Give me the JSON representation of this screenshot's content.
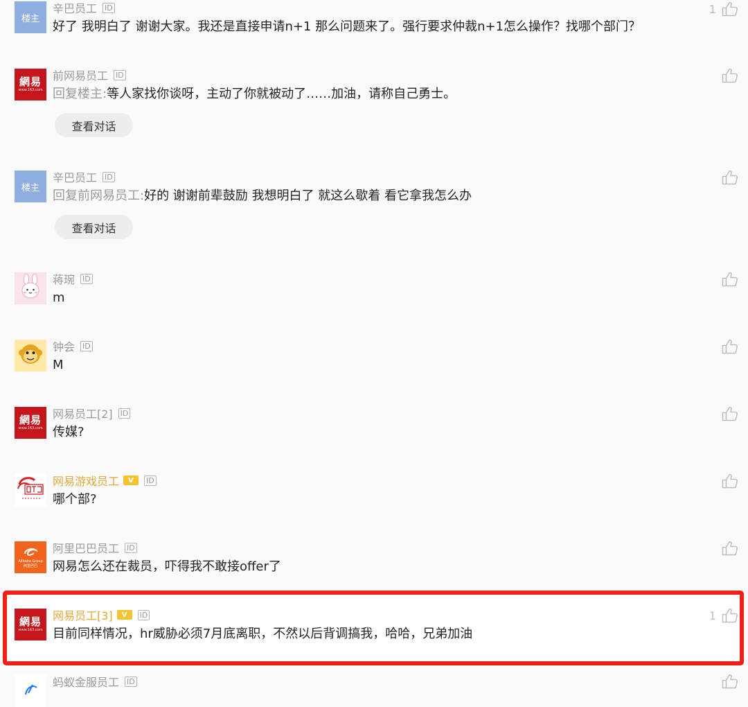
{
  "comments": [
    {
      "user": "辛巴员工",
      "avatar": "楼主",
      "id_badge": "ID",
      "content": "好了 我明白了 谢谢大家。我还是直接申请n+1 那么问题来了。强行要求仲裁n+1怎么操作？找哪个部门？",
      "likes": "1"
    },
    {
      "user": "前网易员工",
      "avatar": "網易",
      "avatar_sub": "www.163.com",
      "id_badge": "ID",
      "reply_to": "回复楼主:",
      "content": "等人家找你谈呀，主动了你就被动了……加油，请称自己勇士。",
      "button": "查看对话"
    },
    {
      "user": "辛巴员工",
      "avatar": "楼主",
      "id_badge": "ID",
      "reply_to": "回复前网易员工:",
      "content": "好的 谢谢前辈鼓励 我想明白了 就这么歇着 看它拿我怎么办",
      "button": "查看对话"
    },
    {
      "user": "蒋琬",
      "avatar_icon": "rabbit-avatar-icon",
      "id_badge": "ID",
      "content": "m"
    },
    {
      "user": "钟会",
      "avatar_icon": "monkey-avatar-icon",
      "id_badge": "ID",
      "content": "M"
    },
    {
      "user": "网易员工[2]",
      "avatar": "網易",
      "avatar_sub": "www.163.com",
      "id_badge": "ID",
      "content": "传媒?"
    },
    {
      "user": "网易游戏员工",
      "avatar_icon": "netease-game-logo-icon",
      "verified": "V",
      "id_badge": "ID",
      "content": "哪个部?"
    },
    {
      "user": "阿里巴巴员工",
      "avatar": "阿里巴巴",
      "avatar_sub": "Alibaba Group",
      "id_badge": "ID",
      "content": "网易怎么还在裁员，吓得我不敢接offer了"
    },
    {
      "user": "网易员工[3]",
      "avatar": "網易",
      "avatar_sub": "www.163.com",
      "verified": "V",
      "id_badge": "ID",
      "content": "目前同样情况，hr威胁必须7月底离职，不然以后背调搞我，哈哈，兄弟加油",
      "likes": "1"
    },
    {
      "user": "蚂蚁金服员工",
      "avatar_icon": "ant-financial-logo-icon",
      "id_badge": "ID"
    }
  ],
  "colors": {
    "highlight_border": "#f01f19",
    "meta_gray": "#9a9a9a",
    "verified_gold": "#e0a838",
    "netease_red": "#c4161c",
    "alibaba_orange": "#f2641e"
  }
}
